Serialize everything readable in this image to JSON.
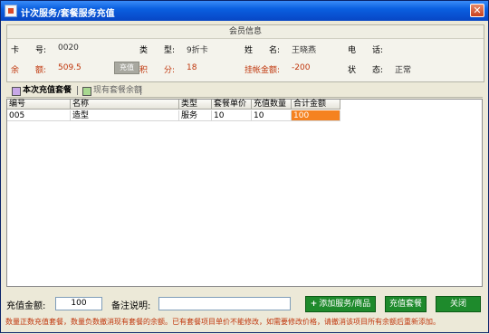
{
  "window": {
    "title": "计次服务/套餐服务充值",
    "close_glyph": "✕"
  },
  "member": {
    "header": "会员信息",
    "card_label": "卡　　号:",
    "card_value": "0020",
    "type_label": "类　　型:",
    "type_value": "9折卡",
    "name_label": "姓　　名:",
    "name_value": "王晓燕",
    "phone_label": "电　　话:",
    "phone_value": "",
    "balance_label": "余　　额:",
    "balance_value": "509.5",
    "recharge_btn": "充值",
    "points_label": "积　　分:",
    "points_value": "18",
    "credit_label": "挂帐金额:",
    "credit_value": "-200",
    "status_label": "状　　态:",
    "status_value": "正常"
  },
  "tabs": {
    "current": "本次充值套餐",
    "existing": "现有套餐余额"
  },
  "grid": {
    "columns": [
      "编号",
      "名称",
      "类型",
      "套餐单价",
      "充值数量",
      "合计金额"
    ],
    "rows": [
      [
        "005",
        "造型",
        "服务",
        "10",
        "10",
        "100"
      ]
    ]
  },
  "bottom": {
    "amount_label": "充值金额:",
    "amount_value": "100",
    "remark_label": "备注说明:",
    "remark_value": "",
    "add_btn": "添加服务/商品",
    "recharge_btn": "充值套餐",
    "close_btn": "关闭",
    "notice": "数量正数充值套餐，数量负数撤消现有套餐的余额。已有套餐项目单价不能修改，如需要修改价格，请撤消该项目所有余额后重新添加。"
  },
  "colors": {
    "accent_red": "#c0360c",
    "highlight_cell": "#f58220",
    "button_green": "#1e8a2c",
    "titlebar_blue": "#0a5fe0"
  }
}
